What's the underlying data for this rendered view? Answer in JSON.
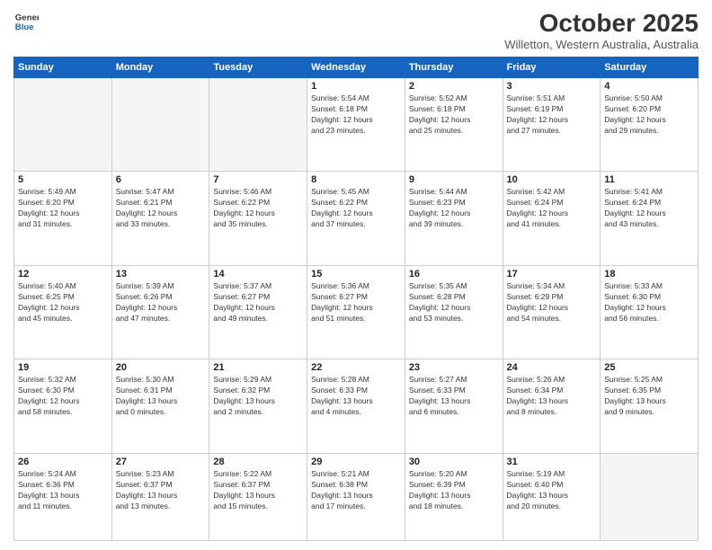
{
  "header": {
    "logo_line1": "General",
    "logo_line2": "Blue",
    "month": "October 2025",
    "location": "Willetton, Western Australia, Australia"
  },
  "weekdays": [
    "Sunday",
    "Monday",
    "Tuesday",
    "Wednesday",
    "Thursday",
    "Friday",
    "Saturday"
  ],
  "weeks": [
    [
      {
        "day": "",
        "info": ""
      },
      {
        "day": "",
        "info": ""
      },
      {
        "day": "",
        "info": ""
      },
      {
        "day": "1",
        "info": "Sunrise: 5:54 AM\nSunset: 6:18 PM\nDaylight: 12 hours\nand 23 minutes."
      },
      {
        "day": "2",
        "info": "Sunrise: 5:52 AM\nSunset: 6:18 PM\nDaylight: 12 hours\nand 25 minutes."
      },
      {
        "day": "3",
        "info": "Sunrise: 5:51 AM\nSunset: 6:19 PM\nDaylight: 12 hours\nand 27 minutes."
      },
      {
        "day": "4",
        "info": "Sunrise: 5:50 AM\nSunset: 6:20 PM\nDaylight: 12 hours\nand 29 minutes."
      }
    ],
    [
      {
        "day": "5",
        "info": "Sunrise: 5:49 AM\nSunset: 6:20 PM\nDaylight: 12 hours\nand 31 minutes."
      },
      {
        "day": "6",
        "info": "Sunrise: 5:47 AM\nSunset: 6:21 PM\nDaylight: 12 hours\nand 33 minutes."
      },
      {
        "day": "7",
        "info": "Sunrise: 5:46 AM\nSunset: 6:22 PM\nDaylight: 12 hours\nand 35 minutes."
      },
      {
        "day": "8",
        "info": "Sunrise: 5:45 AM\nSunset: 6:22 PM\nDaylight: 12 hours\nand 37 minutes."
      },
      {
        "day": "9",
        "info": "Sunrise: 5:44 AM\nSunset: 6:23 PM\nDaylight: 12 hours\nand 39 minutes."
      },
      {
        "day": "10",
        "info": "Sunrise: 5:42 AM\nSunset: 6:24 PM\nDaylight: 12 hours\nand 41 minutes."
      },
      {
        "day": "11",
        "info": "Sunrise: 5:41 AM\nSunset: 6:24 PM\nDaylight: 12 hours\nand 43 minutes."
      }
    ],
    [
      {
        "day": "12",
        "info": "Sunrise: 5:40 AM\nSunset: 6:25 PM\nDaylight: 12 hours\nand 45 minutes."
      },
      {
        "day": "13",
        "info": "Sunrise: 5:39 AM\nSunset: 6:26 PM\nDaylight: 12 hours\nand 47 minutes."
      },
      {
        "day": "14",
        "info": "Sunrise: 5:37 AM\nSunset: 6:27 PM\nDaylight: 12 hours\nand 49 minutes."
      },
      {
        "day": "15",
        "info": "Sunrise: 5:36 AM\nSunset: 6:27 PM\nDaylight: 12 hours\nand 51 minutes."
      },
      {
        "day": "16",
        "info": "Sunrise: 5:35 AM\nSunset: 6:28 PM\nDaylight: 12 hours\nand 53 minutes."
      },
      {
        "day": "17",
        "info": "Sunrise: 5:34 AM\nSunset: 6:29 PM\nDaylight: 12 hours\nand 54 minutes."
      },
      {
        "day": "18",
        "info": "Sunrise: 5:33 AM\nSunset: 6:30 PM\nDaylight: 12 hours\nand 56 minutes."
      }
    ],
    [
      {
        "day": "19",
        "info": "Sunrise: 5:32 AM\nSunset: 6:30 PM\nDaylight: 12 hours\nand 58 minutes."
      },
      {
        "day": "20",
        "info": "Sunrise: 5:30 AM\nSunset: 6:31 PM\nDaylight: 13 hours\nand 0 minutes."
      },
      {
        "day": "21",
        "info": "Sunrise: 5:29 AM\nSunset: 6:32 PM\nDaylight: 13 hours\nand 2 minutes."
      },
      {
        "day": "22",
        "info": "Sunrise: 5:28 AM\nSunset: 6:33 PM\nDaylight: 13 hours\nand 4 minutes."
      },
      {
        "day": "23",
        "info": "Sunrise: 5:27 AM\nSunset: 6:33 PM\nDaylight: 13 hours\nand 6 minutes."
      },
      {
        "day": "24",
        "info": "Sunrise: 5:26 AM\nSunset: 6:34 PM\nDaylight: 13 hours\nand 8 minutes."
      },
      {
        "day": "25",
        "info": "Sunrise: 5:25 AM\nSunset: 6:35 PM\nDaylight: 13 hours\nand 9 minutes."
      }
    ],
    [
      {
        "day": "26",
        "info": "Sunrise: 5:24 AM\nSunset: 6:36 PM\nDaylight: 13 hours\nand 11 minutes."
      },
      {
        "day": "27",
        "info": "Sunrise: 5:23 AM\nSunset: 6:37 PM\nDaylight: 13 hours\nand 13 minutes."
      },
      {
        "day": "28",
        "info": "Sunrise: 5:22 AM\nSunset: 6:37 PM\nDaylight: 13 hours\nand 15 minutes."
      },
      {
        "day": "29",
        "info": "Sunrise: 5:21 AM\nSunset: 6:38 PM\nDaylight: 13 hours\nand 17 minutes."
      },
      {
        "day": "30",
        "info": "Sunrise: 5:20 AM\nSunset: 6:39 PM\nDaylight: 13 hours\nand 18 minutes."
      },
      {
        "day": "31",
        "info": "Sunrise: 5:19 AM\nSunset: 6:40 PM\nDaylight: 13 hours\nand 20 minutes."
      },
      {
        "day": "",
        "info": ""
      }
    ]
  ]
}
